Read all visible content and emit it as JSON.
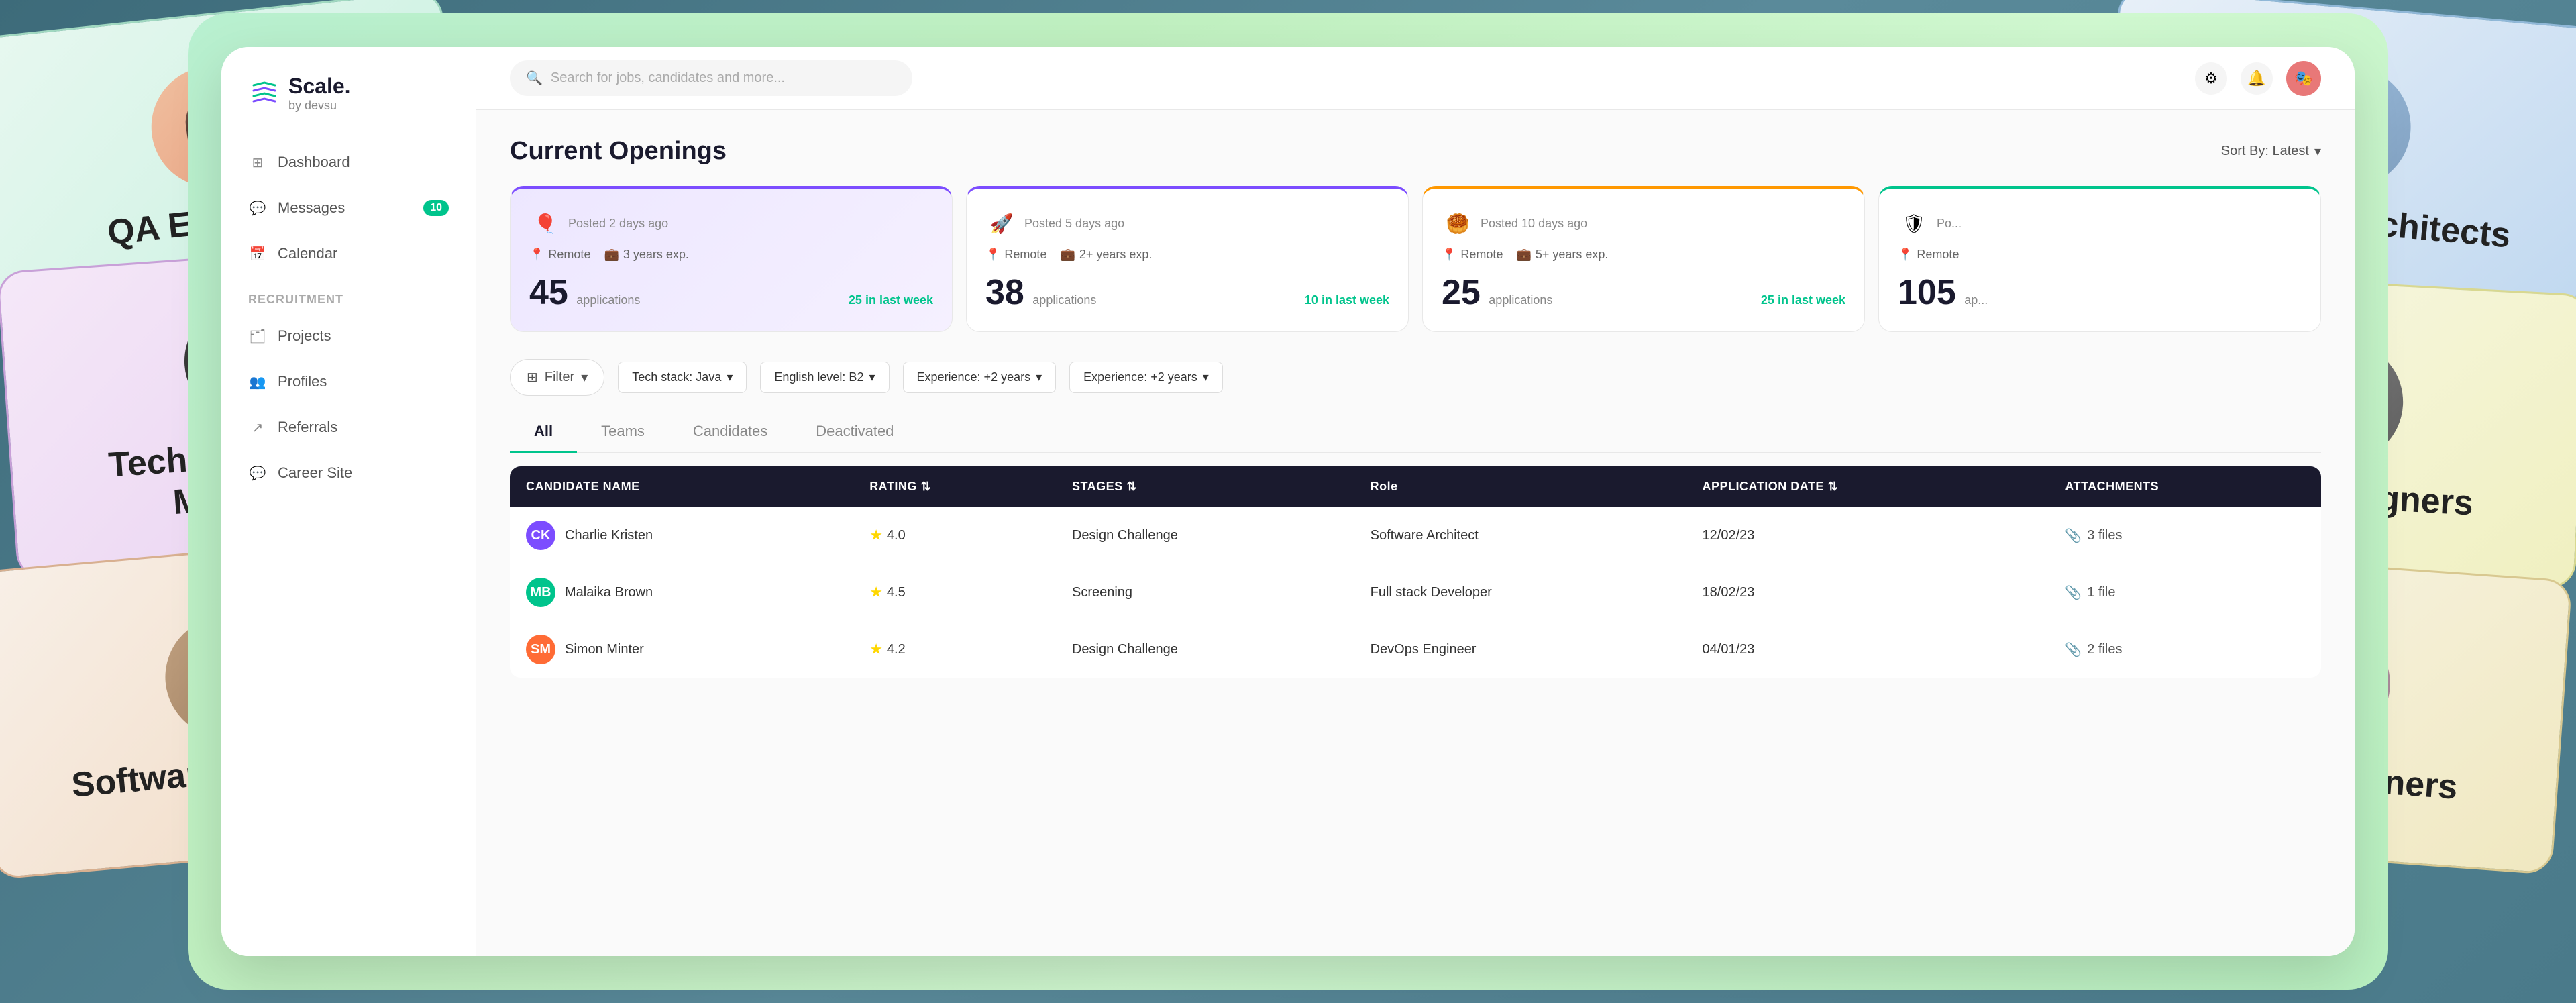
{
  "background": {
    "color": "#4a7a8a"
  },
  "floating_cards": {
    "left": [
      {
        "id": "qa-engineers",
        "label": "QA Engineers",
        "avatar_emoji": "👩",
        "bg_color": "#e8f8f0",
        "border_color": "#a0d8c0"
      },
      {
        "id": "technical-project-managers",
        "label": "Technical Project\nManagers",
        "avatar_emoji": "👩🏽",
        "bg_color": "#f5e8f8",
        "border_color": "#c8a0d8"
      },
      {
        "id": "software-engineers",
        "label": "Software Engineers",
        "avatar_emoji": "👨",
        "bg_color": "#f8f0e8",
        "border_color": "#d8b090"
      }
    ],
    "right": [
      {
        "id": "solutions-architects",
        "label": "Solutions Architects",
        "avatar_emoji": "👨🏼",
        "bg_color": "#e8f0f8",
        "border_color": "#90b8d8"
      },
      {
        "id": "ui-ux-designers",
        "label": "UI/UX Designers",
        "avatar_emoji": "👨🏿",
        "bg_color": "#f8f8e8",
        "border_color": "#d8d890"
      },
      {
        "id": "product-owners",
        "label": "Product Owners",
        "avatar_emoji": "👩🏻",
        "bg_color": "#f8f5e8",
        "border_color": "#d8c890"
      }
    ]
  },
  "app": {
    "logo": {
      "name": "Scale.",
      "sub": "by devsu",
      "icon": "≋"
    },
    "nav": {
      "main_items": [
        {
          "id": "dashboard",
          "label": "Dashboard",
          "icon": "⊞"
        },
        {
          "id": "messages",
          "label": "Messages",
          "icon": "💬",
          "badge": "10"
        },
        {
          "id": "calendar",
          "label": "Calendar",
          "icon": "📅"
        }
      ],
      "section_label": "RECRUITMENT",
      "recruitment_items": [
        {
          "id": "projects",
          "label": "Projects",
          "icon": "🗂"
        },
        {
          "id": "profiles",
          "label": "Profiles",
          "icon": "👥"
        },
        {
          "id": "referrals",
          "label": "Referrals",
          "icon": "↗"
        },
        {
          "id": "career-site",
          "label": "Career Site",
          "icon": "💬"
        }
      ]
    },
    "topbar": {
      "search_placeholder": "Search for jobs, candidates and more...",
      "icons": [
        "⚙",
        "🔔",
        "🎭"
      ]
    },
    "current_openings": {
      "title": "Current Openings",
      "sort_label": "Sort By: Latest",
      "cards": [
        {
          "id": "opening-1",
          "icon": "🎈",
          "posted": "Posted 2 days ago",
          "location": "Remote",
          "experience": "3 years exp.",
          "applications": "45",
          "applications_label": "applications",
          "week_count": "25 in last week",
          "border_color": "#7c4dff"
        },
        {
          "id": "opening-2",
          "icon": "🚀",
          "posted": "Posted 5 days ago",
          "location": "Remote",
          "experience": "2+ years exp.",
          "applications": "38",
          "applications_label": "applications",
          "week_count": "10 in last week",
          "border_color": "#7c4dff"
        },
        {
          "id": "opening-3",
          "icon": "🥮",
          "posted": "Posted 10 days ago",
          "location": "Remote",
          "experience": "5+ years exp.",
          "applications": "25",
          "applications_label": "applications",
          "week_count": "25 in last week",
          "border_color": "#ff9800"
        },
        {
          "id": "opening-4",
          "icon": "🛡",
          "posted": "Po...",
          "location": "Remote",
          "experience": "",
          "applications": "105",
          "applications_label": "ap...",
          "week_count": "",
          "border_color": "#00c48c"
        }
      ]
    },
    "filters": {
      "filter_button": "Filter",
      "chips": [
        {
          "id": "tech-stack",
          "label": "Tech stack: Java"
        },
        {
          "id": "english-level",
          "label": "English level: B2"
        },
        {
          "id": "experience-1",
          "label": "Experience: +2 years"
        },
        {
          "id": "experience-2",
          "label": "Experience: +2 years"
        }
      ]
    },
    "tabs": [
      {
        "id": "all",
        "label": "All",
        "active": true
      },
      {
        "id": "teams",
        "label": "Teams",
        "active": false
      },
      {
        "id": "candidates",
        "label": "Candidates",
        "active": false
      },
      {
        "id": "deactivated",
        "label": "Deactivated",
        "active": false
      }
    ],
    "table": {
      "headers": [
        {
          "id": "name",
          "label": "CANDIDATE NAME"
        },
        {
          "id": "rating",
          "label": "RATING ⇅"
        },
        {
          "id": "stages",
          "label": "STAGES ⇅"
        },
        {
          "id": "role",
          "label": "Role"
        },
        {
          "id": "date",
          "label": "APPLICATION DATE ⇅"
        },
        {
          "id": "attachments",
          "label": "ATTACHMENTS"
        }
      ],
      "rows": [
        {
          "id": "row-1",
          "name": "Charlie Kristen",
          "avatar_color": "#7c4dff",
          "avatar_initials": "CK",
          "rating": "4.0",
          "stage": "Design Challenge",
          "role": "Software Architect",
          "date": "12/02/23",
          "attachments": "3 files"
        },
        {
          "id": "row-2",
          "name": "Malaika Brown",
          "avatar_color": "#00c48c",
          "avatar_initials": "MB",
          "rating": "4.5",
          "stage": "Screening",
          "role": "Full stack Developer",
          "date": "18/02/23",
          "attachments": "1 file"
        },
        {
          "id": "row-3",
          "name": "Simon Minter",
          "avatar_color": "#ff6b35",
          "avatar_initials": "SM",
          "rating": "4.2",
          "stage": "Design Challenge",
          "role": "DevOps Engineer",
          "date": "04/01/23",
          "attachments": "2 files"
        }
      ]
    }
  }
}
